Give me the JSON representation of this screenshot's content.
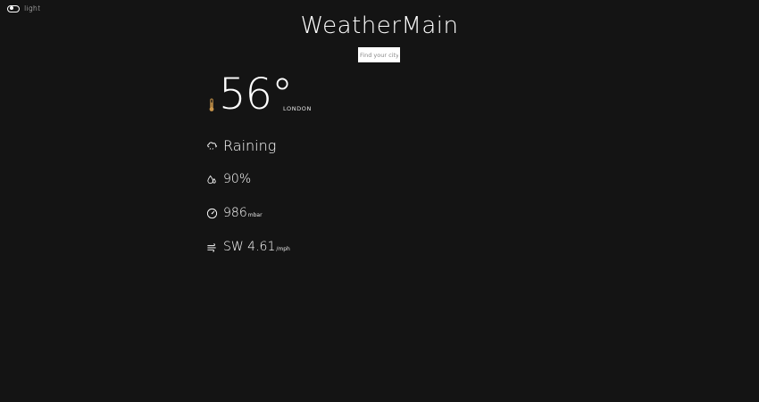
{
  "theme_toggle": {
    "label": "light"
  },
  "header": {
    "title": "WeatherMain"
  },
  "search": {
    "placeholder": "Find your city"
  },
  "current": {
    "temperature": "56°",
    "city": "LONDON"
  },
  "metrics": {
    "condition": {
      "value": "Raining",
      "icon": "cloud-rain-icon"
    },
    "humidity": {
      "value": "90%",
      "icon": "humidity-icon"
    },
    "pressure": {
      "value": "986",
      "unit": "mbar",
      "icon": "pressure-gauge-icon"
    },
    "wind": {
      "value": "SW 4.61",
      "unit": "/mph",
      "icon": "wind-icon"
    }
  },
  "colors": {
    "background": "#141414",
    "text": "#ffffff",
    "thermometer": "#c8944a"
  }
}
